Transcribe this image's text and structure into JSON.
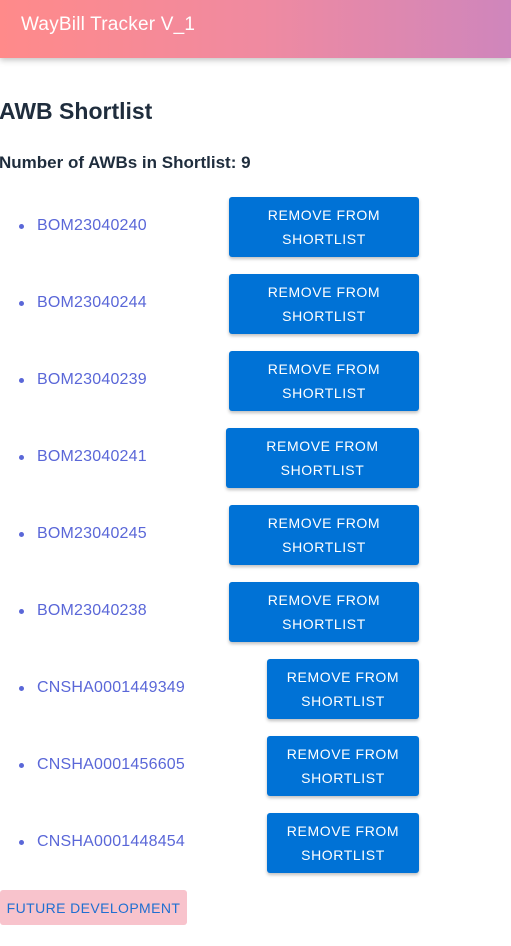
{
  "appbar": {
    "title": "WayBill Tracker V_1"
  },
  "page": {
    "title": "AWB Shortlist",
    "count_label": "Number of AWBs in Shortlist: 9"
  },
  "shortlist": {
    "remove_line1": "REMOVE FROM",
    "remove_line2": "SHORTLIST",
    "items": [
      {
        "awb": "BOM23040240"
      },
      {
        "awb": "BOM23040244"
      },
      {
        "awb": "BOM23040239"
      },
      {
        "awb": "BOM23040241"
      },
      {
        "awb": "BOM23040245"
      },
      {
        "awb": "BOM23040238"
      },
      {
        "awb": "CNSHA0001449349"
      },
      {
        "awb": "CNSHA0001456605"
      },
      {
        "awb": "CNSHA0001448454"
      }
    ]
  },
  "footer": {
    "future_label": "FUTURE DEVELOPMENT"
  },
  "colors": {
    "appbar_start": "#ff8a8a",
    "appbar_end": "#cf86bc",
    "link": "#5a67d8",
    "button": "#0072d6",
    "future_bg": "#f8c3cc"
  }
}
